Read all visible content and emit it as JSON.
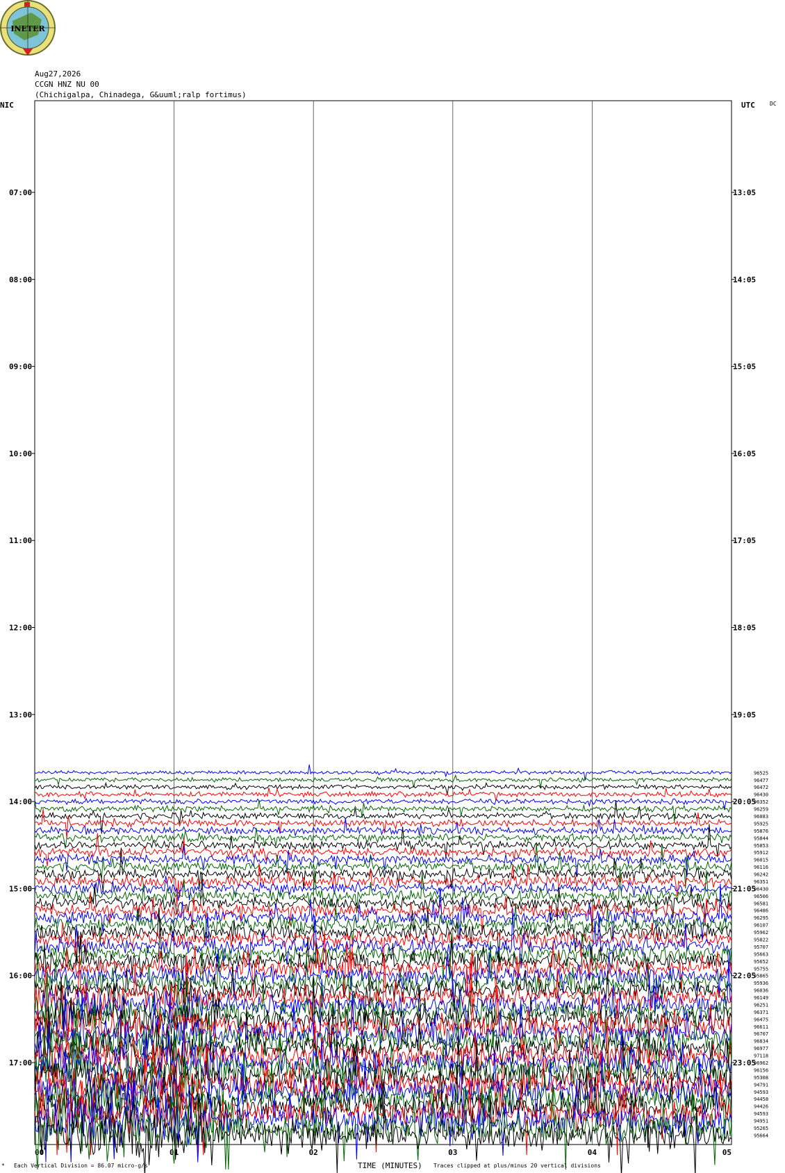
{
  "logo": {
    "text": "INETER"
  },
  "header": {
    "date": "Aug27,2026",
    "station": "CCGN HNZ NU 00",
    "location": "(Chichigalpa, Chinadega, G&uuml;ralp fortimus)"
  },
  "axis": {
    "left_title": "NIC",
    "right_title": "UTC",
    "corner_note": "DC",
    "x_title": "TIME (MINUTES)",
    "footer_left": "Each Vertical Division =  86.07 micro-g/s",
    "footer_right": "Traces clipped at plus/minus 20 vertical divisions",
    "footer_mark": "*"
  },
  "chart_data": {
    "type": "line",
    "title": "",
    "xlabel": "TIME (MINUTES)",
    "x_ticks": [
      "00",
      "01",
      "02",
      "03",
      "04",
      "05"
    ],
    "xlim": [
      0,
      5
    ],
    "left_ticks": [
      "07:00",
      "08:00",
      "09:00",
      "10:00",
      "11:00",
      "12:00",
      "13:00",
      "14:00",
      "15:00",
      "16:00",
      "17:00"
    ],
    "right_ticks": [
      "13:05",
      "14:05",
      "15:05",
      "16:05",
      "17:05",
      "18:05",
      "19:05",
      "20:05",
      "21:05",
      "22:05",
      "23:05"
    ],
    "trace_colors": [
      "#0000ff",
      "#006400",
      "#000000",
      "#ff0000"
    ],
    "first_trace_time": "13:40",
    "trace_interval_minutes": 5,
    "trace_values": [
      "96525",
      "96477",
      "96472",
      "96430",
      "96352",
      "96259",
      "96083",
      "95925",
      "95876",
      "95844",
      "95853",
      "95912",
      "96015",
      "96116",
      "96242",
      "96351",
      "96430",
      "96506",
      "96581",
      "96486",
      "96295",
      "96107",
      "95962",
      "95822",
      "95707",
      "95663",
      "95652",
      "95755",
      "95865",
      "95936",
      "96036",
      "96149",
      "96251",
      "96371",
      "96475",
      "96611",
      "96707",
      "96834",
      "96977",
      "97118",
      "96962",
      "96156",
      "95308",
      "94791",
      "94593",
      "94458",
      "94426",
      "94593",
      "94951",
      "95265",
      "95664"
    ],
    "grid": true
  }
}
